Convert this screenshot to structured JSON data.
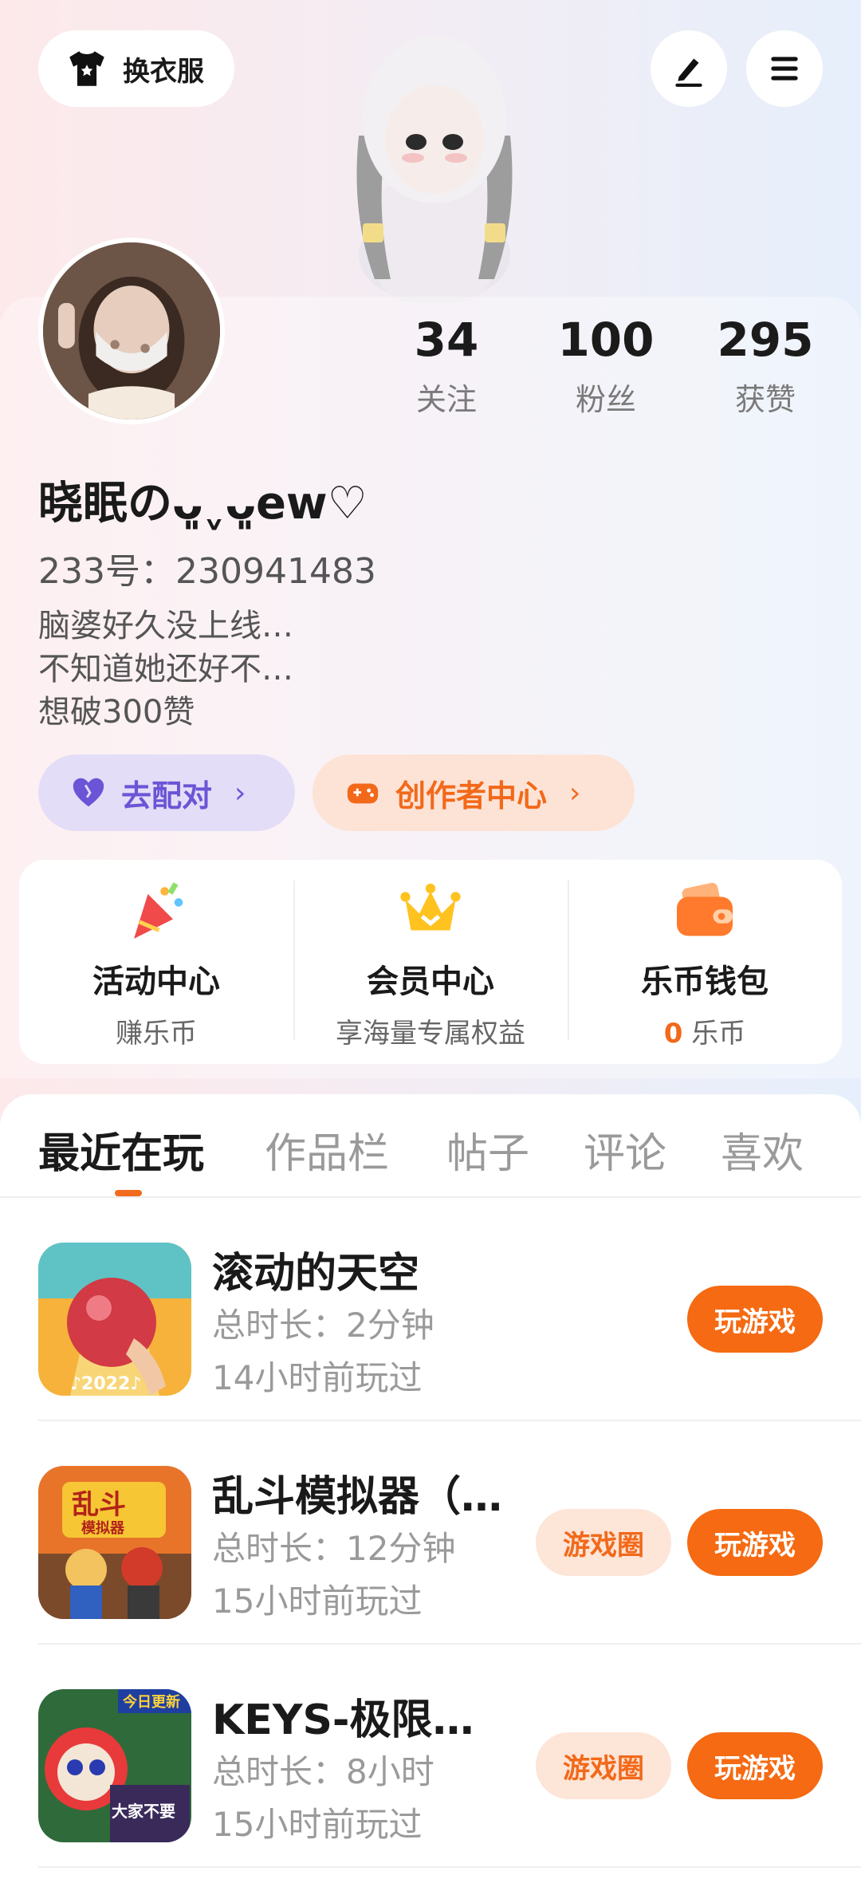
{
  "header": {
    "outfit_label": "换衣服",
    "outfit_icon": "tshirt-icon",
    "edit_icon": "pen-icon",
    "menu_icon": "hamburger-menu-icon"
  },
  "profile": {
    "avatar": "avatar",
    "stats": [
      {
        "value": "34",
        "label": "关注"
      },
      {
        "value": "100",
        "label": "粉丝"
      },
      {
        "value": "295",
        "label": "获赞"
      }
    ],
    "nickname": "晓眠のᴗ͈ˬᴗ͈ew♡",
    "user_id": "233号：230941483",
    "bio": [
      "脑婆好久没上线…",
      "不知道她还好不…",
      "想破300赞"
    ],
    "match_label": "去配对",
    "creator_label": "创作者中心",
    "chevron": "›"
  },
  "services": [
    {
      "title": "活动中心",
      "sub": "赚乐币",
      "icon": "party-popper-icon"
    },
    {
      "title": "会员中心",
      "sub": "享海量专属权益",
      "icon": "crown-icon"
    },
    {
      "title": "乐币钱包",
      "sub_value": "0",
      "sub_unit": " 乐币",
      "icon": "wallet-icon"
    }
  ],
  "tabs": [
    "最近在玩",
    "作品栏",
    "帖子",
    "评论",
    "喜欢"
  ],
  "active_tab": "最近在玩",
  "games": [
    {
      "name": "滚动的天空",
      "time": "总时长：2分钟",
      "ago": "14小时前玩过",
      "play": "玩游戏"
    },
    {
      "name": "乱斗模拟器（…",
      "time": "总时长：12分钟",
      "ago": "15小时前玩过",
      "circle": "游戏圈",
      "play": "玩游戏"
    },
    {
      "name": "KEYS-极限…",
      "time": "总时长：8小时",
      "ago": "15小时前玩过",
      "circle": "游戏圈",
      "play": "玩游戏"
    }
  ],
  "colors": {
    "accent": "#f56a12",
    "match_purple": "#6b55d6",
    "match_bg": "#e4ddf7",
    "creator_bg": "#fde3d6"
  }
}
